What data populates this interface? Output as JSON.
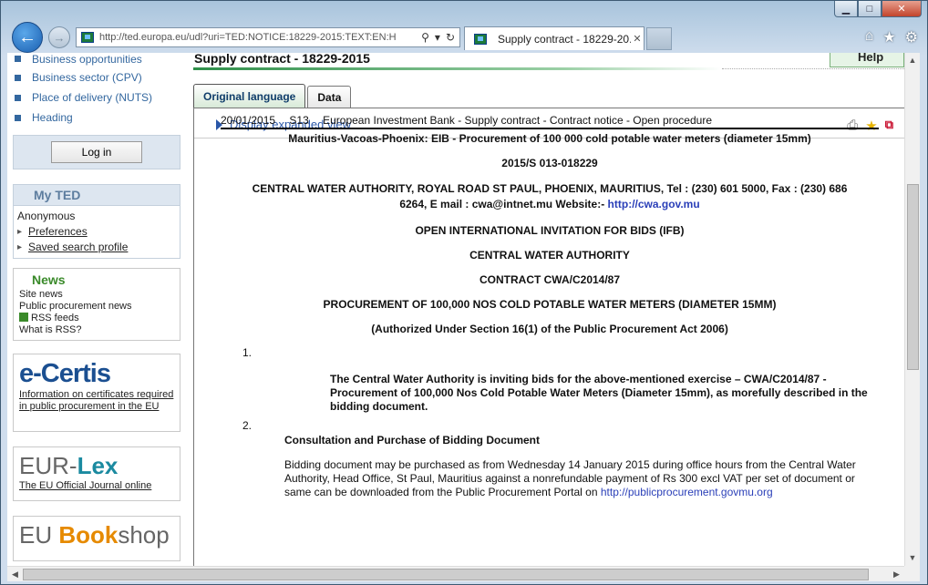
{
  "browser": {
    "address": "http://ted.europa.eu/udl?uri=TED:NOTICE:18229-2015:TEXT:EN:H",
    "address_domain": "ted.europa.eu",
    "tab_title": "Supply contract - 18229-20..."
  },
  "sidebar": {
    "menu": [
      {
        "label": "Business opportunities"
      },
      {
        "label": "Business sector (CPV)"
      },
      {
        "label": "Place of delivery (NUTS)"
      },
      {
        "label": "Heading"
      }
    ],
    "login_label": "Log in",
    "myted_title": "My TED",
    "myted_user": "Anonymous",
    "myted_links": [
      "Preferences",
      "Saved search profile"
    ],
    "news_title": "News",
    "news_items": [
      "Site news",
      "Public procurement news",
      "RSS feeds",
      "What is RSS?"
    ],
    "ecertis_link": "Information on certificates required in public procurement in the EU",
    "eurlex_link": "The EU Official Journal online"
  },
  "main": {
    "page_title": "Supply contract - 18229-2015",
    "help_label": "Help",
    "tabs": [
      "Original language",
      "Data"
    ],
    "expand_label": "Display expanded view",
    "doc": {
      "date": "20/01/2015",
      "section": "S13",
      "head": "European Investment Bank - Supply contract - Contract notice - Open procedure",
      "title": "Mauritius-Vacoas-Phoenix: EIB - Procurement of 100 000 cold potable water meters (diameter 15mm)",
      "ref": "2015/S 013-018229",
      "authority_line1": "CENTRAL WATER AUTHORITY, ROYAL ROAD ST PAUL, PHOENIX, MAURITIUS, Tel : (230) 601 5000, Fax : (230) 686",
      "authority_line2": "6264, E mail : cwa@intnet.mu Website:- ",
      "authority_link": "http://cwa.gov.mu",
      "ifb": "OPEN INTERNATIONAL INVITATION FOR BIDS (IFB)",
      "cwa": "CENTRAL WATER AUTHORITY",
      "contract": "CONTRACT CWA/C2014/87",
      "procurement": "PROCUREMENT OF 100,000 NOS COLD POTABLE WATER METERS (DIAMETER 15MM)",
      "authorized": "(Authorized Under Section 16(1) of the Public Procurement Act 2006)",
      "item1_num": "1.",
      "item1_text": "The Central Water Authority is inviting bids for the above-mentioned exercise – CWA/C2014/87 - Procurement of 100,000 Nos Cold Potable Water Meters (Diameter 15mm), as morefully described in the bidding document.",
      "item2_num": "2.",
      "item2_heading": "Consultation and Purchase of Bidding Document",
      "item2_text": "Bidding document may be purchased as from Wednesday 14 January 2015 during office hours from the Central Water Authority, Head Office, St Paul, Mauritius against a nonrefundable payment of Rs 300 excl VAT per set of document or same can be downloaded from the Public Procurement Portal on ",
      "item2_link": "http://publicprocurement.govmu.org"
    }
  }
}
